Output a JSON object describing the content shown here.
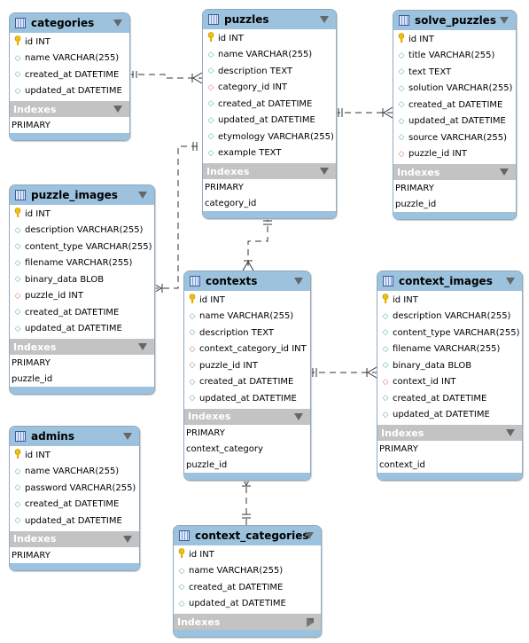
{
  "tables": [
    {
      "id": "categories",
      "name": "categories",
      "columns": [
        {
          "name": "id INT",
          "kind": "pk"
        },
        {
          "name": "name VARCHAR(255)",
          "kind": "attr"
        },
        {
          "name": "created_at DATETIME",
          "kind": "attr"
        },
        {
          "name": "updated_at DATETIME",
          "kind": "attr"
        }
      ],
      "indexes_label": "Indexes",
      "indexes": [
        "PRIMARY"
      ]
    },
    {
      "id": "puzzles",
      "name": "puzzles",
      "columns": [
        {
          "name": "id INT",
          "kind": "pk"
        },
        {
          "name": "name VARCHAR(255)",
          "kind": "attr"
        },
        {
          "name": "description TEXT",
          "kind": "attr"
        },
        {
          "name": "category_id INT",
          "kind": "fk"
        },
        {
          "name": "created_at DATETIME",
          "kind": "attr"
        },
        {
          "name": "updated_at DATETIME",
          "kind": "attr"
        },
        {
          "name": "etymology VARCHAR(255)",
          "kind": "attr"
        },
        {
          "name": "example TEXT",
          "kind": "attr"
        }
      ],
      "indexes_label": "Indexes",
      "indexes": [
        "PRIMARY",
        "category_id"
      ]
    },
    {
      "id": "solve_puzzles",
      "name": "solve_puzzles",
      "columns": [
        {
          "name": "id INT",
          "kind": "pk"
        },
        {
          "name": "title VARCHAR(255)",
          "kind": "attr"
        },
        {
          "name": "text TEXT",
          "kind": "attr"
        },
        {
          "name": "solution VARCHAR(255)",
          "kind": "attr"
        },
        {
          "name": "created_at DATETIME",
          "kind": "attr"
        },
        {
          "name": "updated_at DATETIME",
          "kind": "attr"
        },
        {
          "name": "source VARCHAR(255)",
          "kind": "attr"
        },
        {
          "name": "puzzle_id INT",
          "kind": "fk"
        }
      ],
      "indexes_label": "Indexes",
      "indexes": [
        "PRIMARY",
        "puzzle_id"
      ]
    },
    {
      "id": "puzzle_images",
      "name": "puzzle_images",
      "columns": [
        {
          "name": "id INT",
          "kind": "pk"
        },
        {
          "name": "description VARCHAR(255)",
          "kind": "attr"
        },
        {
          "name": "content_type VARCHAR(255)",
          "kind": "attr"
        },
        {
          "name": "filename VARCHAR(255)",
          "kind": "attr"
        },
        {
          "name": "binary_data BLOB",
          "kind": "attr"
        },
        {
          "name": "puzzle_id INT",
          "kind": "fk"
        },
        {
          "name": "created_at DATETIME",
          "kind": "attr"
        },
        {
          "name": "updated_at DATETIME",
          "kind": "attr"
        }
      ],
      "indexes_label": "Indexes",
      "indexes": [
        "PRIMARY",
        "puzzle_id"
      ]
    },
    {
      "id": "contexts",
      "name": "contexts",
      "columns": [
        {
          "name": "id INT",
          "kind": "pk"
        },
        {
          "name": "name VARCHAR(255)",
          "kind": "attr"
        },
        {
          "name": "description TEXT",
          "kind": "attr"
        },
        {
          "name": "context_category_id INT",
          "kind": "fk"
        },
        {
          "name": "puzzle_id INT",
          "kind": "fk"
        },
        {
          "name": "created_at DATETIME",
          "kind": "attr"
        },
        {
          "name": "updated_at DATETIME",
          "kind": "attr"
        }
      ],
      "indexes_label": "Indexes",
      "indexes": [
        "PRIMARY",
        "context_category",
        "puzzle_id"
      ]
    },
    {
      "id": "context_images",
      "name": "context_images",
      "columns": [
        {
          "name": "id INT",
          "kind": "pk"
        },
        {
          "name": "description VARCHAR(255)",
          "kind": "attr"
        },
        {
          "name": "content_type VARCHAR(255)",
          "kind": "attr"
        },
        {
          "name": "filename VARCHAR(255)",
          "kind": "attr"
        },
        {
          "name": "binary_data BLOB",
          "kind": "attr"
        },
        {
          "name": "context_id INT",
          "kind": "fk"
        },
        {
          "name": "created_at DATETIME",
          "kind": "attr"
        },
        {
          "name": "updated_at DATETIME",
          "kind": "attr"
        }
      ],
      "indexes_label": "Indexes",
      "indexes": [
        "PRIMARY",
        "context_id"
      ]
    },
    {
      "id": "admins",
      "name": "admins",
      "columns": [
        {
          "name": "id INT",
          "kind": "pk"
        },
        {
          "name": "name VARCHAR(255)",
          "kind": "attr"
        },
        {
          "name": "password VARCHAR(255)",
          "kind": "attr"
        },
        {
          "name": "created_at DATETIME",
          "kind": "attr"
        },
        {
          "name": "updated_at DATETIME",
          "kind": "attr"
        }
      ],
      "indexes_label": "Indexes",
      "indexes": [
        "PRIMARY"
      ]
    },
    {
      "id": "context_categories",
      "name": "context_categories",
      "columns": [
        {
          "name": "id INT",
          "kind": "pk"
        },
        {
          "name": "name VARCHAR(255)",
          "kind": "attr"
        },
        {
          "name": "created_at DATETIME",
          "kind": "attr"
        },
        {
          "name": "updated_at DATETIME",
          "kind": "attr"
        }
      ],
      "indexes_label": "Indexes",
      "indexes": [],
      "indexes_collapsed": true
    }
  ],
  "colors": {
    "header": "#9cc2de",
    "indexes_bar": "#c3c3c3",
    "primary_key": "#e5b800",
    "foreign_key": "#cc7777",
    "attribute": "#5aa7b8"
  }
}
